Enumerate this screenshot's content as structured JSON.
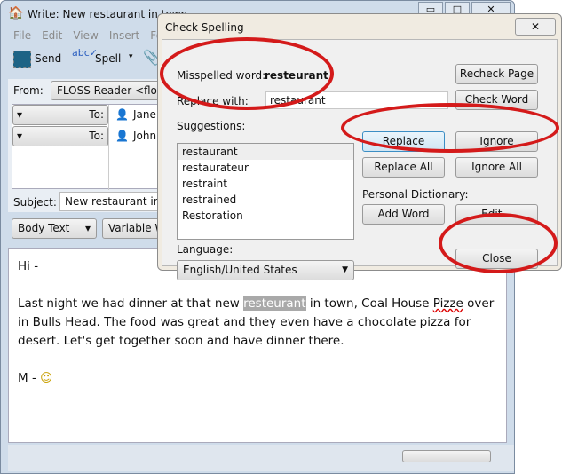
{
  "window": {
    "title": "Write: New restaurant in town",
    "controls": [
      "minimize",
      "maximize",
      "close"
    ]
  },
  "menu": [
    "File",
    "Edit",
    "View",
    "Insert",
    "Form"
  ],
  "toolbar": {
    "send": "Send",
    "spell": "Spell"
  },
  "header": {
    "from_label": "From:",
    "from_value": "FLOSS Reader <floss.re",
    "recipients": [
      {
        "type": "To:",
        "name": "Jane I"
      },
      {
        "type": "To:",
        "name": "John"
      }
    ],
    "subject_label": "Subject:",
    "subject_value": "New restaurant in to",
    "format": "Body Text",
    "font": "Variable W"
  },
  "body": {
    "greeting": "Hi -",
    "p_before": "Last night we had dinner at that new ",
    "misspelled": "resteurant",
    "p_mid": " in town, Coal House ",
    "pizze": "Pizze",
    "p_after": " over in Bulls Head. The food was great and they even have a chocolate pizza for desert. Let's get together soon and have dinner there.",
    "signoff": "M - ",
    "smiley": "☺"
  },
  "dialog": {
    "title": "Check Spelling",
    "misspelled_label": "Misspelled word:",
    "misspelled_word": "resteurant",
    "replace_label": "Replace with:",
    "replace_value": "restaurant",
    "suggestions_label": "Suggestions:",
    "suggestions": [
      "restaurant",
      "restaurateur",
      "restraint",
      "restrained",
      "Restoration"
    ],
    "language_label": "Language:",
    "language": "English/United States",
    "personal_dict_label": "Personal Dictionary:",
    "buttons": {
      "recheck": "Recheck Page",
      "check_word": "Check Word",
      "replace": "Replace",
      "ignore": "Ignore",
      "replace_all": "Replace All",
      "ignore_all": "Ignore All",
      "add_word": "Add Word",
      "edit": "Edit...",
      "close": "Close"
    }
  },
  "annotation_color": "#d41a1a"
}
